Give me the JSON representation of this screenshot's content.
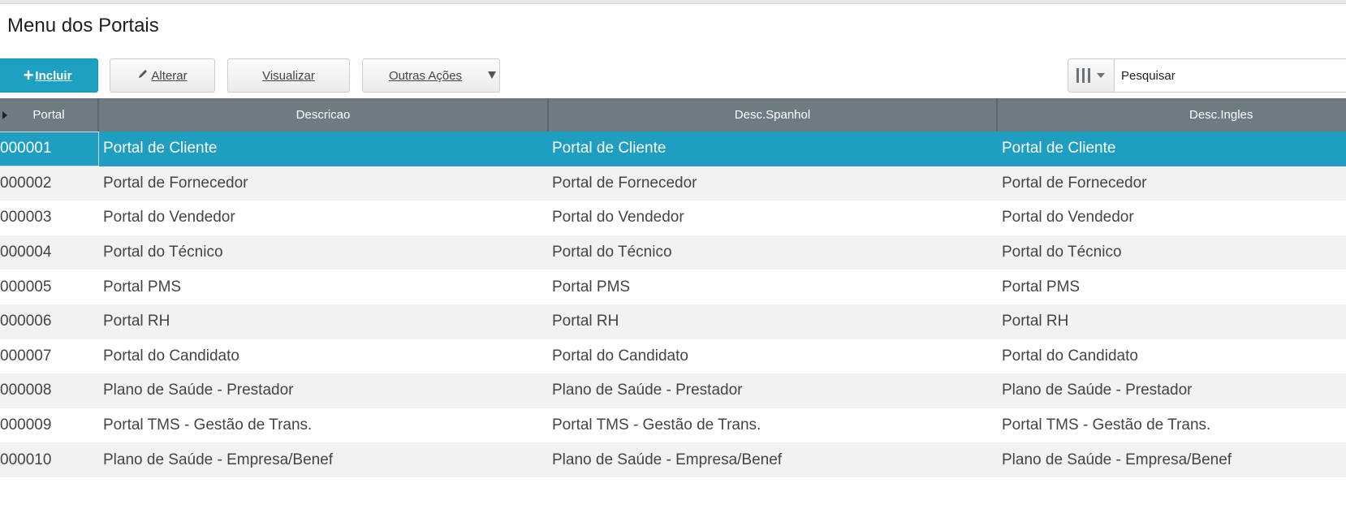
{
  "page": {
    "title": "Menu dos Portais"
  },
  "toolbar": {
    "incluir_label": "Incluir",
    "alterar_label": "Alterar",
    "visualizar_label": "Visualizar",
    "outras_label": "Outras Ações"
  },
  "search": {
    "placeholder": "Pesquisar"
  },
  "colors": {
    "accent": "#1ea0c3",
    "header": "#6e7b82",
    "row_alt": "#f2f2f2"
  },
  "grid": {
    "columns": [
      "Portal",
      "Descricao",
      "Desc.Spanhol",
      "Desc.Ingles"
    ],
    "selected_index": 0,
    "rows": [
      {
        "portal": "000001",
        "descricao": "Portal de Cliente",
        "spanhol": "Portal de Cliente",
        "ingles": "Portal de Cliente"
      },
      {
        "portal": "000002",
        "descricao": "Portal de Fornecedor",
        "spanhol": "Portal de Fornecedor",
        "ingles": "Portal de Fornecedor"
      },
      {
        "portal": "000003",
        "descricao": "Portal do Vendedor",
        "spanhol": "Portal do Vendedor",
        "ingles": "Portal do Vendedor"
      },
      {
        "portal": "000004",
        "descricao": "Portal do Técnico",
        "spanhol": "Portal do Técnico",
        "ingles": "Portal do Técnico"
      },
      {
        "portal": "000005",
        "descricao": "Portal PMS",
        "spanhol": "Portal PMS",
        "ingles": "Portal PMS"
      },
      {
        "portal": "000006",
        "descricao": "Portal RH",
        "spanhol": "Portal RH",
        "ingles": "Portal RH"
      },
      {
        "portal": "000007",
        "descricao": "Portal do Candidato",
        "spanhol": "Portal do Candidato",
        "ingles": "Portal do Candidato"
      },
      {
        "portal": "000008",
        "descricao": "Plano de Saúde - Prestador",
        "spanhol": "Plano de Saúde - Prestador",
        "ingles": "Plano de Saúde - Prestador"
      },
      {
        "portal": "000009",
        "descricao": "Portal TMS - Gestão de Trans.",
        "spanhol": "Portal TMS - Gestão de Trans.",
        "ingles": "Portal TMS - Gestão de Trans."
      },
      {
        "portal": "000010",
        "descricao": "Plano de Saúde - Empresa/Benef",
        "spanhol": "Plano de Saúde - Empresa/Benef",
        "ingles": "Plano de Saúde - Empresa/Benef"
      }
    ]
  }
}
